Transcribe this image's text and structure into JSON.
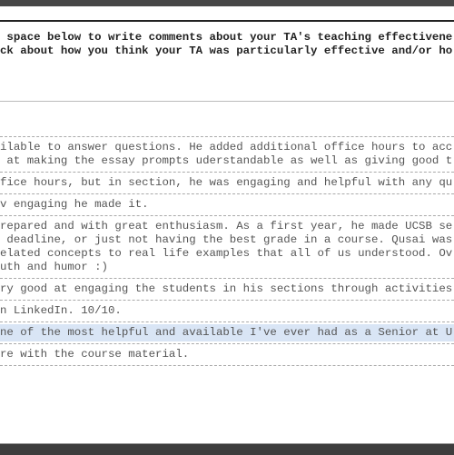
{
  "instructions": [
    " space below to write comments about your TA's teaching effectivene",
    "ck about how you think your TA was particularly effective and/or ho"
  ],
  "comments": [
    {
      "lines": [
        "ilable to answer questions. He added additional office hours to acc",
        " at making the essay prompts uderstandable as well as giving good t"
      ],
      "highlighted": false
    },
    {
      "lines": [
        "fice hours, but in section, he was engaging and helpful with any qu"
      ],
      "highlighted": false
    },
    {
      "lines": [
        "v engaging he made it."
      ],
      "highlighted": false
    },
    {
      "lines": [
        "repared and with great enthusiasm. As a first year, he made UCSB se",
        " deadline, or just not having the best grade in a course. Qusai was",
        "elated concepts to real life examples that all of us understood. Ov",
        "uth and humor :)"
      ],
      "highlighted": false
    },
    {
      "lines": [
        "ry good at engaging the students in his sections through activities"
      ],
      "highlighted": false
    },
    {
      "lines": [
        "n LinkedIn. 10/10."
      ],
      "highlighted": false
    },
    {
      "lines": [
        "ne of the most helpful and available I've ever had as a Senior at U"
      ],
      "highlighted": true
    },
    {
      "lines": [
        "re with the course material."
      ],
      "highlighted": false
    }
  ],
  "colors": {
    "highlight": "#d9e5f5",
    "text": "#555555",
    "frame": "#474747"
  }
}
